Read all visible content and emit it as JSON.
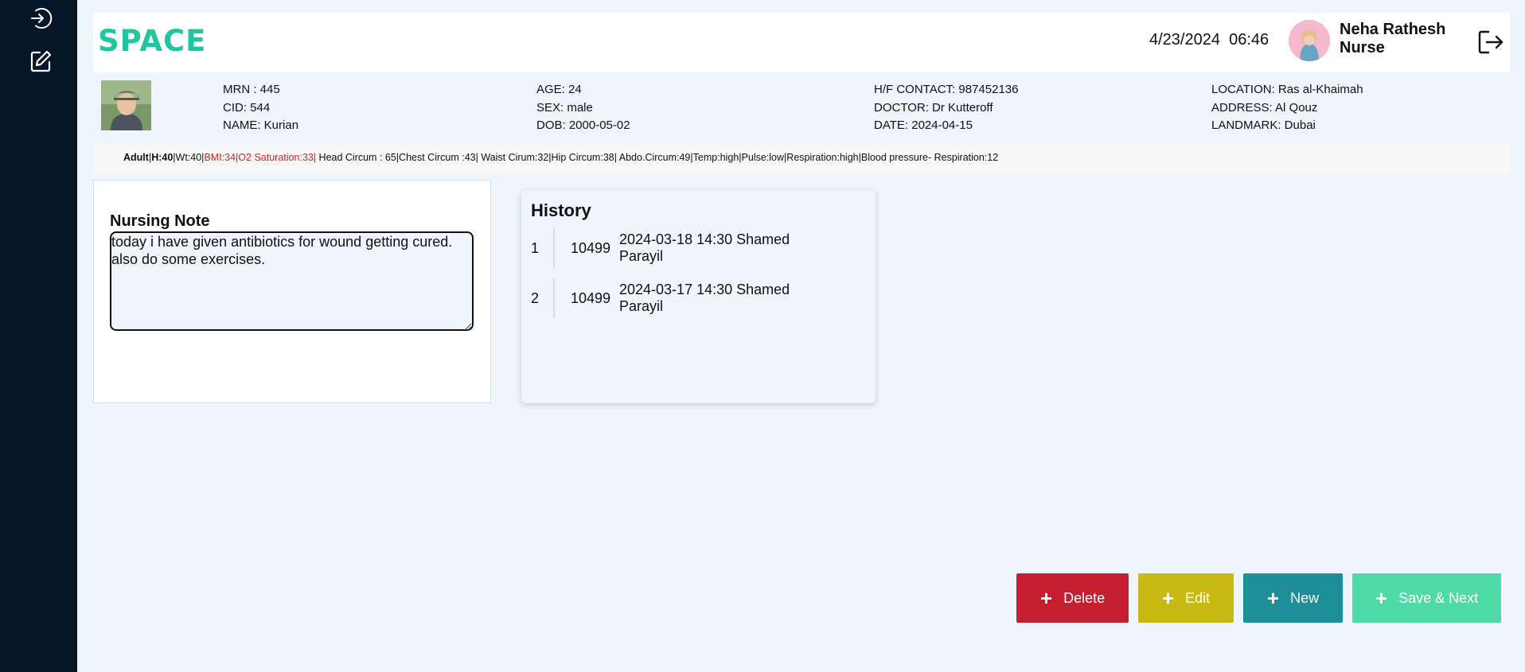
{
  "sidebar": {
    "items": [
      {
        "icon": "login-icon"
      },
      {
        "icon": "edit-icon"
      }
    ]
  },
  "header": {
    "logo": "SPACE",
    "date": "4/23/2024",
    "time": "06:46",
    "user_name": "Neha Rathesh",
    "user_role": "Nurse",
    "brand_color": "#1fc7a0"
  },
  "patient": {
    "mrn": "MRN : 445",
    "cid": "CID: 544",
    "name": "NAME: Kurian",
    "age": "AGE: 24",
    "sex": "SEX: male",
    "dob": "DOB: 2000-05-02",
    "contact": "H/F CONTACT: 987452136",
    "doctor": "DOCTOR: Dr Kutteroff",
    "date": "DATE: 2024-04-15",
    "location": "LOCATION: Ras al-Khaimah",
    "address": "ADDRESS: Al Qouz",
    "landmark": "LANDMARK: Dubai"
  },
  "vitals": {
    "category": "Adult",
    "height": "H:40",
    "weight": "|Wt:40|",
    "bmi": "BMI:34",
    "o2": "|O2 Saturation:33|",
    "rest": " Head Circum : 65|Chest Circum :43| Waist Cirum:32|Hip Circum:38| Abdo.Circum:49|Temp:high|Pulse:low|Respiration:high|Blood pressure- Respiration:12"
  },
  "nursing_note": {
    "label": "Nursing Note",
    "text": "today i have given antibiotics for wound getting cured. also do some exercises."
  },
  "history": {
    "title": "History",
    "rows": [
      {
        "index": "1",
        "id": "10499",
        "desc": "2024-03-18 14:30 Shamed Parayil"
      },
      {
        "index": "2",
        "id": "10499",
        "desc": "2024-03-17 14:30 Shamed Parayil"
      }
    ]
  },
  "actions": {
    "delete": {
      "label": "Delete",
      "color": "#c41e30"
    },
    "edit": {
      "label": "Edit",
      "color": "#c8b914"
    },
    "new": {
      "label": "New",
      "color": "#1e8e98"
    },
    "save_next": {
      "label": "Save & Next",
      "color": "#4fdba8"
    }
  }
}
